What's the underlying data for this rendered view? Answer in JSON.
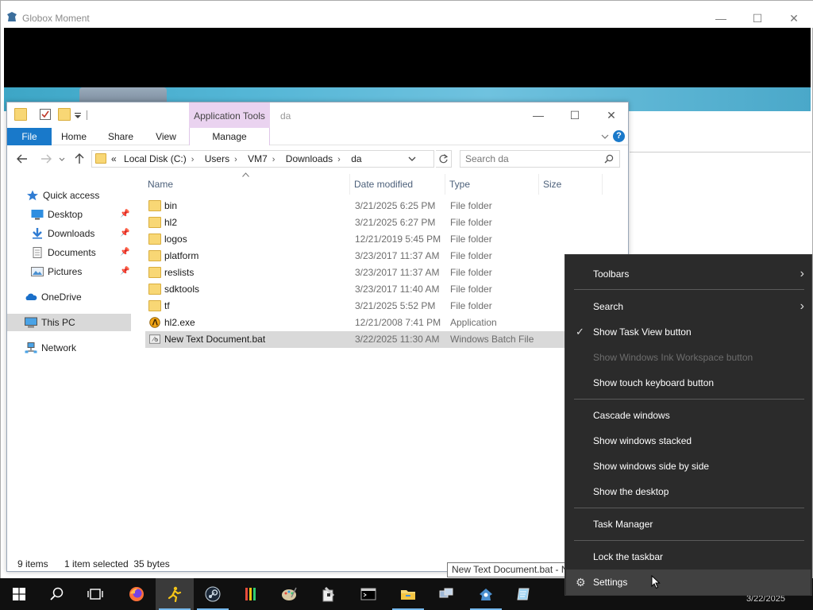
{
  "back_window": {
    "title": "Globox Moment",
    "minimize": "—",
    "maximize": "☐",
    "close": "✕"
  },
  "explorer": {
    "ribbon_context": "Application Tools",
    "window_name": "da",
    "tabs": {
      "file": "File",
      "home": "Home",
      "share": "Share",
      "view": "View",
      "manage": "Manage"
    },
    "controls": {
      "minimize": "—",
      "maximize": "☐",
      "close": "✕"
    },
    "help": "?",
    "address": {
      "overflow": "«",
      "crumbs": [
        "Local Disk (C:)",
        "Users",
        "VM7",
        "Downloads",
        "da"
      ],
      "separator": "›"
    },
    "search": {
      "placeholder": "Search da",
      "value": ""
    },
    "nav": {
      "quick_access": "Quick access",
      "desktop": "Desktop",
      "downloads": "Downloads",
      "documents": "Documents",
      "pictures": "Pictures",
      "onedrive": "OneDrive",
      "this_pc": "This PC",
      "network": "Network"
    },
    "columns": {
      "name": "Name",
      "date": "Date modified",
      "type": "Type",
      "size": "Size"
    },
    "files": [
      {
        "name": "bin",
        "date": "3/21/2025 6:25 PM",
        "type": "File folder",
        "icon": "folder-icon"
      },
      {
        "name": "hl2",
        "date": "3/21/2025 6:27 PM",
        "type": "File folder",
        "icon": "folder-icon"
      },
      {
        "name": "logos",
        "date": "12/21/2019 5:45 PM",
        "type": "File folder",
        "icon": "folder-icon"
      },
      {
        "name": "platform",
        "date": "3/23/2017 11:37 AM",
        "type": "File folder",
        "icon": "folder-icon"
      },
      {
        "name": "reslists",
        "date": "3/23/2017 11:37 AM",
        "type": "File folder",
        "icon": "folder-icon"
      },
      {
        "name": "sdktools",
        "date": "3/23/2017 11:40 AM",
        "type": "File folder",
        "icon": "folder-icon"
      },
      {
        "name": "tf",
        "date": "3/21/2025 5:52 PM",
        "type": "File folder",
        "icon": "folder-icon"
      },
      {
        "name": "hl2.exe",
        "date": "12/21/2008 7:41 PM",
        "type": "Application",
        "icon": "half-life-icon"
      },
      {
        "name": "New Text Document.bat",
        "date": "3/22/2025 11:30 AM",
        "type": "Windows Batch File",
        "icon": "batch-file-icon"
      }
    ],
    "status": {
      "items": "9 items",
      "selected": "1 item selected  35 bytes"
    }
  },
  "tooltip": "New Text Document.bat - N",
  "context_menu": {
    "items": [
      {
        "label": "Toolbars",
        "submenu": true
      },
      {
        "label": "Search",
        "submenu": true
      },
      {
        "label": "Show Task View button",
        "checked": true
      },
      {
        "label": "Show Windows Ink Workspace button",
        "disabled": true
      },
      {
        "label": "Show touch keyboard button"
      },
      {
        "label": "Cascade windows"
      },
      {
        "label": "Show windows stacked"
      },
      {
        "label": "Show windows side by side"
      },
      {
        "label": "Show the desktop"
      },
      {
        "label": "Task Manager"
      },
      {
        "label": "Lock the taskbar"
      },
      {
        "label": "Settings",
        "hovered": true
      }
    ],
    "check_glyph": "✓",
    "arrow_glyph": "›",
    "gear_glyph": "⚙"
  },
  "taskbar": {
    "clock_partial": "3/22/2025",
    "colors": {
      "background": "#101010",
      "accent": "#76b9ed"
    }
  }
}
